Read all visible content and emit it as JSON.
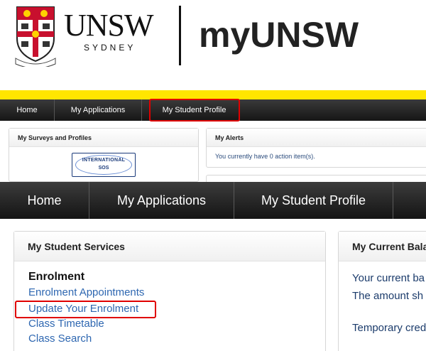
{
  "header": {
    "university": "UNSW",
    "city": "SYDNEY",
    "site_title": "myUNSW"
  },
  "colors": {
    "accent_yellow": "#ffe600",
    "nav_dark": "#1c1c1c",
    "highlight_red": "#e00000",
    "link_blue": "#2e67b1"
  },
  "top_nav": {
    "items": [
      {
        "label": "Home"
      },
      {
        "label": "My Applications"
      },
      {
        "label": "My Student Profile"
      }
    ]
  },
  "top_panels": {
    "surveys_title": "My Surveys and Profiles",
    "sos_logo": {
      "line1": "INTERNATIONAL",
      "line2": "SOS"
    },
    "alerts_title": "My Alerts",
    "alerts_text": "You currently have 0 action item(s)."
  },
  "main_nav": {
    "items": [
      {
        "label": "Home"
      },
      {
        "label": "My Applications"
      },
      {
        "label": "My Student Profile"
      }
    ]
  },
  "student_services": {
    "title": "My Student Services",
    "section": "Enrolment",
    "links": [
      "Enrolment Appointments",
      "Update Your Enrolment",
      "Class Timetable",
      "Class Search"
    ]
  },
  "balance": {
    "title": "My Current Bala",
    "lines": [
      "Your current ba",
      "The amount sh",
      "Temporary cred"
    ]
  }
}
